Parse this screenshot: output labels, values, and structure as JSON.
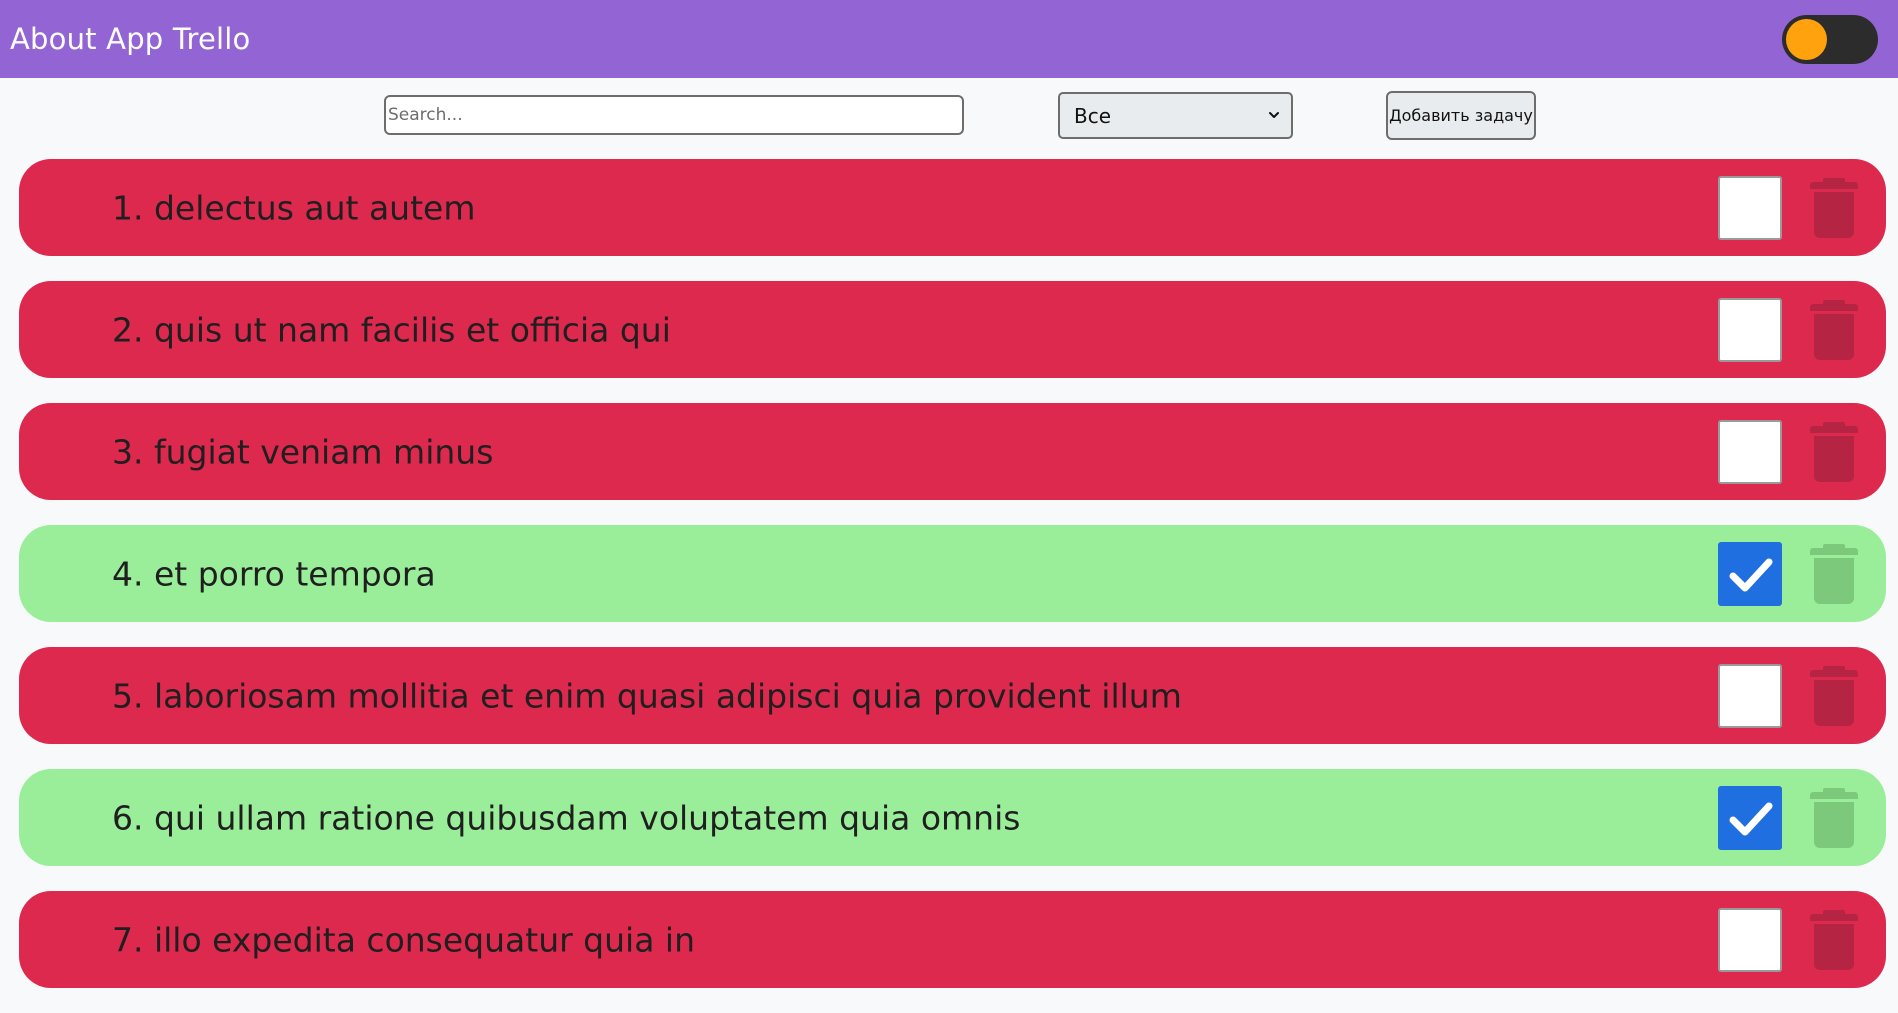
{
  "header": {
    "title": "About App Trello",
    "theme_toggle_icon": "toggle-switch-icon"
  },
  "toolbar": {
    "search_placeholder": "Search...",
    "search_value": "",
    "filter_selected": "Все",
    "add_button_label": "Добавить задачу"
  },
  "colors": {
    "header_bg": "#9364d4",
    "toggle_knob": "#ffa20d",
    "pending_row": "#dd294d",
    "done_row": "#9aee9a",
    "checkbox_checked": "#1f6fe0"
  },
  "tasks": [
    {
      "label": "1. delectus aut autem",
      "completed": false,
      "icon": "trash-icon"
    },
    {
      "label": "2. quis ut nam facilis et officia qui",
      "completed": false,
      "icon": "trash-icon"
    },
    {
      "label": "3. fugiat veniam minus",
      "completed": false,
      "icon": "trash-icon"
    },
    {
      "label": "4. et porro tempora",
      "completed": true,
      "icon": "trash-icon"
    },
    {
      "label": "5. laboriosam mollitia et enim quasi adipisci quia provident illum",
      "completed": false,
      "icon": "trash-icon"
    },
    {
      "label": "6. qui ullam ratione quibusdam voluptatem quia omnis",
      "completed": true,
      "icon": "trash-icon"
    },
    {
      "label": "7. illo expedita consequatur quia in",
      "completed": false,
      "icon": "trash-icon"
    }
  ]
}
